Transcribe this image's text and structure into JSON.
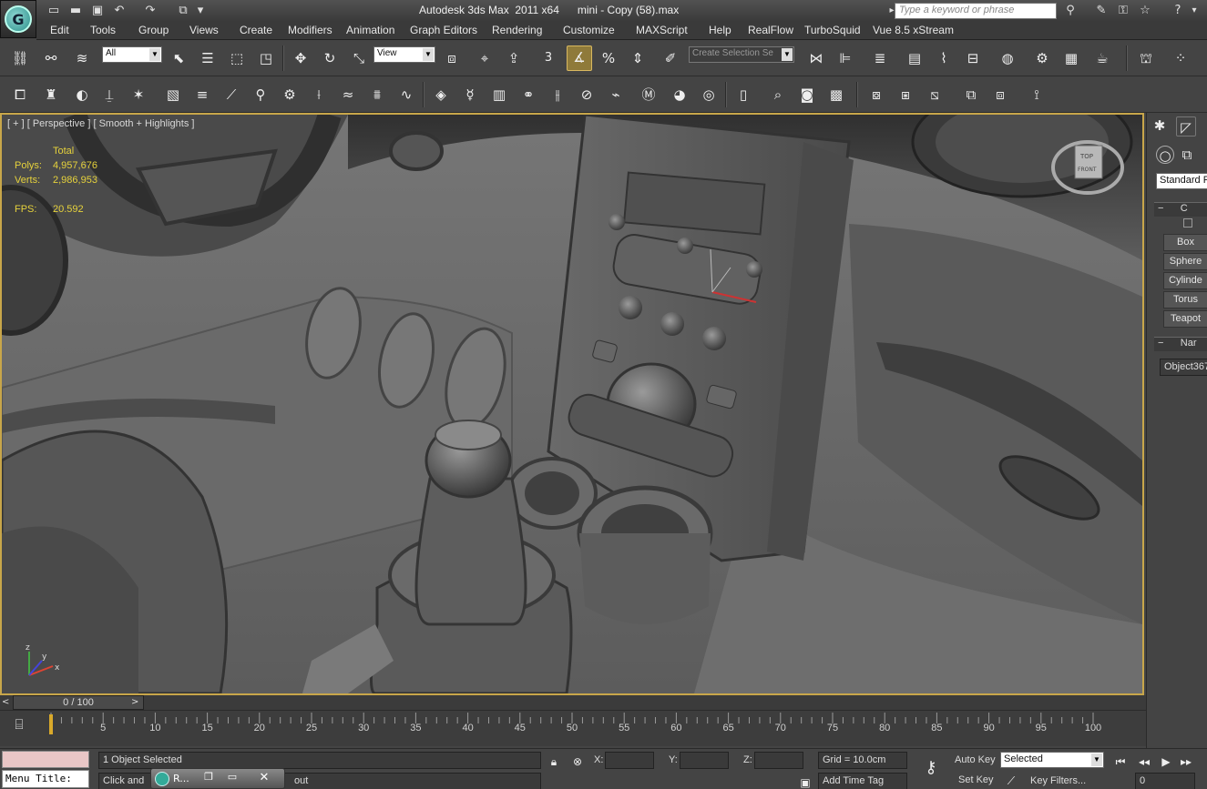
{
  "window": {
    "title": "Autodesk 3ds Max  2011 x64      mini - Copy (58).max",
    "search_placeholder": "Type a keyword or phrase"
  },
  "menu": [
    "Edit",
    "Tools",
    "Group",
    "Views",
    "Create",
    "Modifiers",
    "Animation",
    "Graph Editors",
    "Rendering",
    "Customize",
    "MAXScript",
    "Help",
    "RealFlow",
    "TurboSquid",
    "Vue 8.5 xStream"
  ],
  "toolbar": {
    "selection_filter": "All",
    "reference_coord": "View",
    "snap_angle_label": "3",
    "named_selection_placeholder": "Create Selection Se"
  },
  "viewport": {
    "label": "[ + ] [ Perspective ] [ Smooth + Highlights ]",
    "stats": {
      "header": "Total",
      "polys_label": "Polys:",
      "polys_value": "4,957,676",
      "verts_label": "Verts:",
      "verts_value": "2,986,953",
      "fps_label": "FPS:",
      "fps_value": "20.592"
    },
    "viewcube_top": "TOP",
    "viewcube_front": "FRONT",
    "axis_labels": {
      "x": "x",
      "y": "y",
      "z": "z"
    }
  },
  "command_panel": {
    "category": "Standard P",
    "rollout_object_type": "C",
    "buttons": [
      "Box",
      "Sphere",
      "Cylinde",
      "Torus",
      "Teapot"
    ],
    "rollout_name": "Nar",
    "object_name": "Object367"
  },
  "timeline": {
    "slider_label": "0 / 100",
    "ticks": [
      "5",
      "10",
      "15",
      "20",
      "25",
      "30",
      "35",
      "40",
      "45",
      "50",
      "55",
      "60",
      "65",
      "70",
      "75",
      "80",
      "85",
      "90",
      "95",
      "100"
    ]
  },
  "status": {
    "selection": "1 Object Selected",
    "prompt": "Click and",
    "prompt_end": "out",
    "x_label": "X:",
    "y_label": "Y:",
    "z_label": "Z:",
    "grid": "Grid = 10.0cm",
    "add_time_tag": "Add Time Tag",
    "auto_key": "Auto Key",
    "set_key": "Set Key",
    "key_mode": "Selected",
    "key_filters": "Key Filters...",
    "frame": "0",
    "maxscript_label": "Menu Title:",
    "taskbar_label": "R..."
  }
}
